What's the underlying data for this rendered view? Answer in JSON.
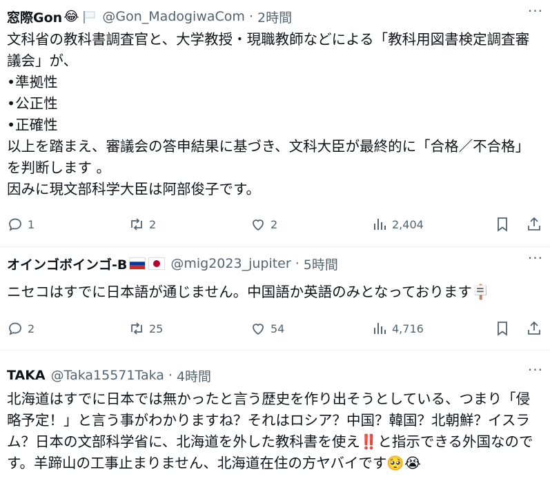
{
  "tweets": [
    {
      "name": "窓際Gon",
      "name_emoji": "😂",
      "handle": "@Gon_MadogiwaCom",
      "sep": "·",
      "time": "2時間",
      "more": "···",
      "body": "文科省の教科書調査官と、大学教授・現職教師などによる「教科用図書検定調査審議会」が、\n•準拠性\n•公正性\n•正確性\n以上を踏まえ、審議会の答申結果に基づき、文科大臣が最終的に「合格／不合格」を判断します 。\n因みに現文部科学大臣は阿部俊子です。",
      "replies": "1",
      "retweets": "2",
      "likes": "2",
      "views": "2,404"
    },
    {
      "name": "オインゴボインゴ-B",
      "handle": "@mig2023_jupiter",
      "sep": "·",
      "time": "5時間",
      "more": "···",
      "body": "ニセコはすでに日本語が通じません。中国語か英語のみとなっております🪧",
      "replies": "2",
      "retweets": "25",
      "likes": "54",
      "views": "4,716"
    },
    {
      "name": "TAKA",
      "handle": "@Taka15571Taka",
      "sep": "·",
      "time": "4時間",
      "more": "···",
      "body": "北海道はすでに日本では無かったと言う歴史を作り出そうとしている、つまり「侵略予定！」と言う事がわかりますね？それはロシア？中国？韓国？北朝鮮？イスラム？日本の文部科学省に、北海道を外した教科書を使え‼️と指示できる外国なのです。羊蹄山の工事止まりません、北海道在住の方ヤバイです🥺😭"
    }
  ]
}
